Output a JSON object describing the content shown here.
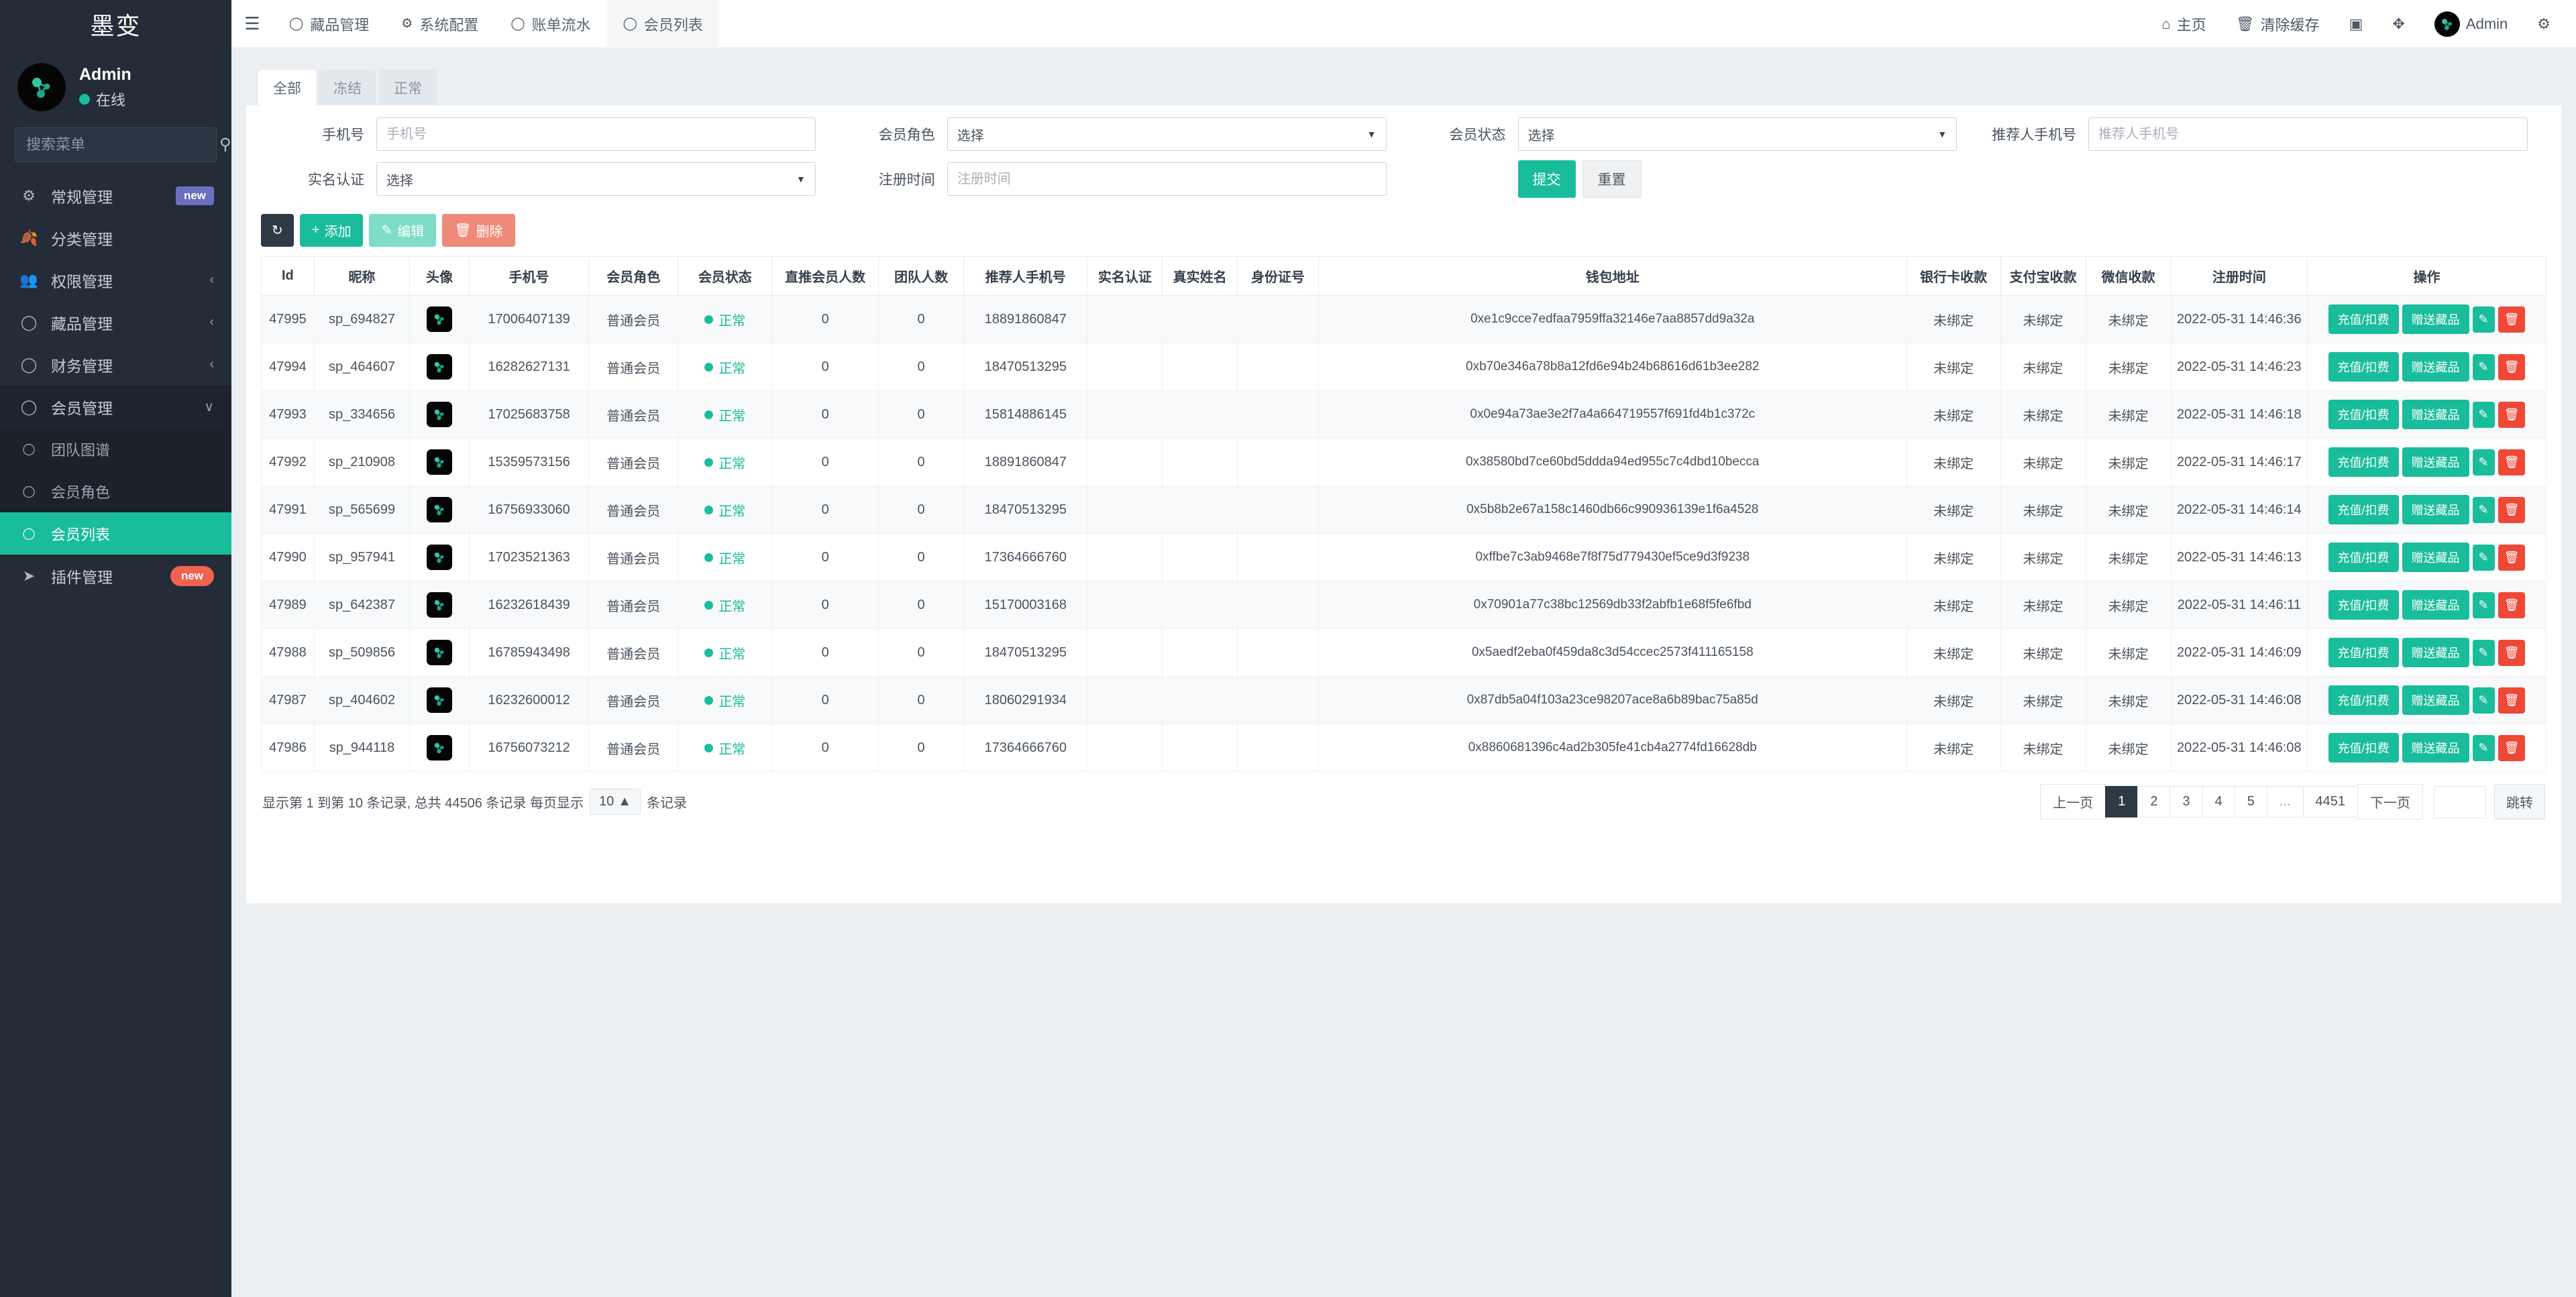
{
  "sidebar": {
    "brand": "墨变",
    "user": {
      "name": "Admin",
      "status": "在线"
    },
    "search_placeholder": "搜索菜单",
    "items": [
      {
        "label": "常规管理",
        "icon": "cogs-icon",
        "badge": "new",
        "badge_color": "#6a6fbe",
        "caret": ""
      },
      {
        "label": "分类管理",
        "icon": "leaf-icon",
        "badge": "",
        "caret": ""
      },
      {
        "label": "权限管理",
        "icon": "users-icon",
        "badge": "",
        "caret": "‹"
      },
      {
        "label": "藏品管理",
        "icon": "circle-icon",
        "badge": "",
        "caret": "‹"
      },
      {
        "label": "财务管理",
        "icon": "circle-icon",
        "badge": "",
        "caret": "‹"
      },
      {
        "label": "会员管理",
        "icon": "circle-icon",
        "badge": "",
        "caret": "∨"
      }
    ],
    "submenu": [
      {
        "label": "团队图谱",
        "icon": "circle-icon",
        "active": false
      },
      {
        "label": "会员角色",
        "icon": "circle-icon",
        "active": false
      },
      {
        "label": "会员列表",
        "icon": "circle-icon",
        "active": true
      }
    ],
    "plugin": {
      "label": "插件管理",
      "icon": "rocket-icon",
      "badge": "new",
      "badge_color": "#f0634f"
    }
  },
  "topbar": {
    "menu_icon": "hamburger-icon",
    "tabs": [
      {
        "label": "藏品管理",
        "icon": "circle-icon",
        "active": false
      },
      {
        "label": "系统配置",
        "icon": "gear-icon",
        "active": false
      },
      {
        "label": "账单流水",
        "icon": "circle-icon",
        "active": false
      },
      {
        "label": "会员列表",
        "icon": "circle-icon",
        "active": true
      }
    ],
    "right": [
      {
        "label": "主页",
        "icon": "home-icon"
      },
      {
        "label": "清除缓存",
        "icon": "trash-icon"
      },
      {
        "label": "",
        "icon": "language-icon"
      },
      {
        "label": "",
        "icon": "fullscreen-icon"
      },
      {
        "label": "Admin",
        "icon": "avatar-icon"
      },
      {
        "label": "",
        "icon": "settings-gear-icon"
      }
    ]
  },
  "filter_tabs": [
    {
      "label": "全部",
      "active": true
    },
    {
      "label": "冻结",
      "active": false
    },
    {
      "label": "正常",
      "active": false
    }
  ],
  "search_form": {
    "phone": {
      "label": "手机号",
      "placeholder": "手机号",
      "value": ""
    },
    "member_role": {
      "label": "会员角色",
      "value": "选择"
    },
    "member_status": {
      "label": "会员状态",
      "value": "选择"
    },
    "referrer_phone": {
      "label": "推荐人手机号",
      "placeholder": "推荐人手机号",
      "value": ""
    },
    "realname_auth": {
      "label": "实名认证",
      "value": "选择"
    },
    "register_time": {
      "label": "注册时间",
      "placeholder": "注册时间",
      "value": ""
    },
    "submit_label": "提交",
    "reset_label": "重置"
  },
  "toolbar": {
    "refresh_label": "",
    "add_label": "添加",
    "edit_label": "编辑",
    "delete_label": "删除"
  },
  "table": {
    "columns": [
      "Id",
      "昵称",
      "头像",
      "手机号",
      "会员角色",
      "会员状态",
      "直推会员人数",
      "团队人数",
      "推荐人手机号",
      "实名认证",
      "真实姓名",
      "身份证号",
      "钱包地址",
      "银行卡收款",
      "支付宝收款",
      "微信收款",
      "注册时间",
      "操作"
    ],
    "rows": [
      {
        "id": "47995",
        "nick": "sp_694827",
        "phone": "17006407139",
        "role": "普通会员",
        "status": "正常",
        "direct": "0",
        "team": "0",
        "referrer": "18891860847",
        "realname_auth": "",
        "realname": "",
        "idcard": "",
        "wallet": "0xe1c9cce7edfaa7959ffa32146e7aa8857dd9a32a",
        "bank": "未绑定",
        "alipay": "未绑定",
        "wechat": "未绑定",
        "reg_time": "2022-05-31 14:46:36"
      },
      {
        "id": "47994",
        "nick": "sp_464607",
        "phone": "16282627131",
        "role": "普通会员",
        "status": "正常",
        "direct": "0",
        "team": "0",
        "referrer": "18470513295",
        "realname_auth": "",
        "realname": "",
        "idcard": "",
        "wallet": "0xb70e346a78b8a12fd6e94b24b68616d61b3ee282",
        "bank": "未绑定",
        "alipay": "未绑定",
        "wechat": "未绑定",
        "reg_time": "2022-05-31 14:46:23"
      },
      {
        "id": "47993",
        "nick": "sp_334656",
        "phone": "17025683758",
        "role": "普通会员",
        "status": "正常",
        "direct": "0",
        "team": "0",
        "referrer": "15814886145",
        "realname_auth": "",
        "realname": "",
        "idcard": "",
        "wallet": "0x0e94a73ae3e2f7a4a664719557f691fd4b1c372c",
        "bank": "未绑定",
        "alipay": "未绑定",
        "wechat": "未绑定",
        "reg_time": "2022-05-31 14:46:18"
      },
      {
        "id": "47992",
        "nick": "sp_210908",
        "phone": "15359573156",
        "role": "普通会员",
        "status": "正常",
        "direct": "0",
        "team": "0",
        "referrer": "18891860847",
        "realname_auth": "",
        "realname": "",
        "idcard": "",
        "wallet": "0x38580bd7ce60bd5ddda94ed955c7c4dbd10becca",
        "bank": "未绑定",
        "alipay": "未绑定",
        "wechat": "未绑定",
        "reg_time": "2022-05-31 14:46:17"
      },
      {
        "id": "47991",
        "nick": "sp_565699",
        "phone": "16756933060",
        "role": "普通会员",
        "status": "正常",
        "direct": "0",
        "team": "0",
        "referrer": "18470513295",
        "realname_auth": "",
        "realname": "",
        "idcard": "",
        "wallet": "0x5b8b2e67a158c1460db66c990936139e1f6a4528",
        "bank": "未绑定",
        "alipay": "未绑定",
        "wechat": "未绑定",
        "reg_time": "2022-05-31 14:46:14"
      },
      {
        "id": "47990",
        "nick": "sp_957941",
        "phone": "17023521363",
        "role": "普通会员",
        "status": "正常",
        "direct": "0",
        "team": "0",
        "referrer": "17364666760",
        "realname_auth": "",
        "realname": "",
        "idcard": "",
        "wallet": "0xffbe7c3ab9468e7f8f75d779430ef5ce9d3f9238",
        "bank": "未绑定",
        "alipay": "未绑定",
        "wechat": "未绑定",
        "reg_time": "2022-05-31 14:46:13"
      },
      {
        "id": "47989",
        "nick": "sp_642387",
        "phone": "16232618439",
        "role": "普通会员",
        "status": "正常",
        "direct": "0",
        "team": "0",
        "referrer": "15170003168",
        "realname_auth": "",
        "realname": "",
        "idcard": "",
        "wallet": "0x70901a77c38bc12569db33f2abfb1e68f5fe6fbd",
        "bank": "未绑定",
        "alipay": "未绑定",
        "wechat": "未绑定",
        "reg_time": "2022-05-31 14:46:11"
      },
      {
        "id": "47988",
        "nick": "sp_509856",
        "phone": "16785943498",
        "role": "普通会员",
        "status": "正常",
        "direct": "0",
        "team": "0",
        "referrer": "18470513295",
        "realname_auth": "",
        "realname": "",
        "idcard": "",
        "wallet": "0x5aedf2eba0f459da8c3d54ccec2573f411165158",
        "bank": "未绑定",
        "alipay": "未绑定",
        "wechat": "未绑定",
        "reg_time": "2022-05-31 14:46:09"
      },
      {
        "id": "47987",
        "nick": "sp_404602",
        "phone": "16232600012",
        "role": "普通会员",
        "status": "正常",
        "direct": "0",
        "team": "0",
        "referrer": "18060291934",
        "realname_auth": "",
        "realname": "",
        "idcard": "",
        "wallet": "0x87db5a04f103a23ce98207ace8a6b89bac75a85d",
        "bank": "未绑定",
        "alipay": "未绑定",
        "wechat": "未绑定",
        "reg_time": "2022-05-31 14:46:08"
      },
      {
        "id": "47986",
        "nick": "sp_944118",
        "phone": "16756073212",
        "role": "普通会员",
        "status": "正常",
        "direct": "0",
        "team": "0",
        "referrer": "17364666760",
        "realname_auth": "",
        "realname": "",
        "idcard": "",
        "wallet": "0x8860681396c4ad2b305fe41cb4a2774fd16628db",
        "bank": "未绑定",
        "alipay": "未绑定",
        "wechat": "未绑定",
        "reg_time": "2022-05-31 14:46:08"
      }
    ],
    "row_actions": {
      "recharge_label": "充值/扣费",
      "gift_label": "赠送藏品",
      "edit_icon": "pencil-icon",
      "delete_icon": "trash-icon"
    }
  },
  "footer": {
    "info_prefix": "显示第 1 到第 10 条记录, 总共 44506 条记录 每页显示",
    "page_size": "10",
    "info_suffix": "条记录",
    "prev_label": "上一页",
    "next_label": "下一页",
    "pages": [
      "1",
      "2",
      "3",
      "4",
      "5",
      "...",
      "4451"
    ],
    "active_page": "1",
    "jump_label": "跳转",
    "jump_value": ""
  },
  "colors": {
    "accent": "#19bd9b",
    "sidebar": "#232c37",
    "danger": "#ef4836",
    "dark": "#2e3a46"
  }
}
